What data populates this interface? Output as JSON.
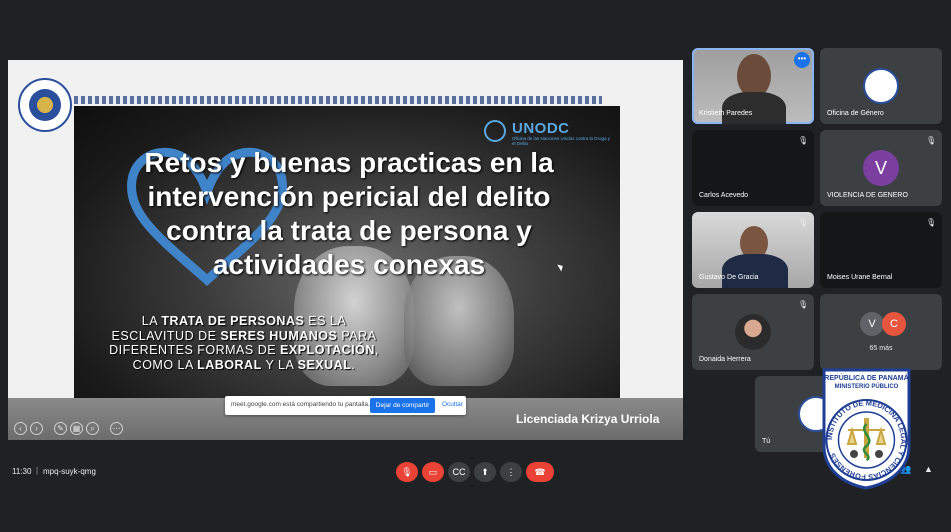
{
  "slide": {
    "logo_text": "REPÚBLICA DE PANAMÁ MINISTERIO PÚBLICO",
    "unodc_title": "UNODC",
    "unodc_subtitle": "Oficina de las Naciones Unidas contra la Droga y el Delito",
    "title": "Retos y buenas practicas en la intervención pericial del delito contra la trata de persona y actividades conexas",
    "quote_parts": [
      {
        "text": "LA ",
        "bold": false
      },
      {
        "text": "TRATA DE PERSONAS",
        "bold": true
      },
      {
        "text": " ES LA ESCLAVITUD DE ",
        "bold": false
      },
      {
        "text": "SERES HUMANOS",
        "bold": true
      },
      {
        "text": " PARA DIFERENTES FORMAS DE ",
        "bold": false
      },
      {
        "text": "EXPLOTACIÓN",
        "bold": true
      },
      {
        "text": ", COMO LA ",
        "bold": false
      },
      {
        "text": "LABORAL",
        "bold": true
      },
      {
        "text": " Y LA ",
        "bold": false
      },
      {
        "text": "SEXUAL",
        "bold": true
      },
      {
        "text": ".",
        "bold": false
      }
    ],
    "author": "Licenciada Krizya Urriola",
    "heart_color": "#3f83c9"
  },
  "share_bar": {
    "message": "meet.google.com está compartiendo tu pantalla.",
    "stop_label": "Dejar de compartir",
    "hide_label": "Ocultar"
  },
  "participants": [
    {
      "name": "Kristieth Paredes",
      "type": "video-woman"
    },
    {
      "name": "Oficina de Género",
      "type": "logo"
    },
    {
      "name": "Carlos Acevedo",
      "type": "dark"
    },
    {
      "name": "VIOLENCIA DE GENERO",
      "type": "avatar",
      "initial": "V",
      "color": "#7b3fa0"
    },
    {
      "name": "Gustavo De Gracia",
      "type": "video-man"
    },
    {
      "name": "Moises Urane Bernal",
      "type": "dark"
    },
    {
      "name": "Donaida Herrera",
      "type": "photo"
    },
    {
      "name": "",
      "type": "more",
      "initials": [
        "V",
        "C"
      ],
      "more_label": "65 más"
    },
    {
      "name": "Tú",
      "type": "self"
    }
  ],
  "meeting": {
    "time": "11:30",
    "separator": "|",
    "code": "mpq-suyk-qmg"
  },
  "seal": {
    "top_text": "REPÚBLICA DE PANAMÁ",
    "sub_text": "MINISTERIO PÚBLICO",
    "ring_text": "INSTITUTO DE MEDICINA LEGAL Y CIENCIAS FORENSES"
  }
}
